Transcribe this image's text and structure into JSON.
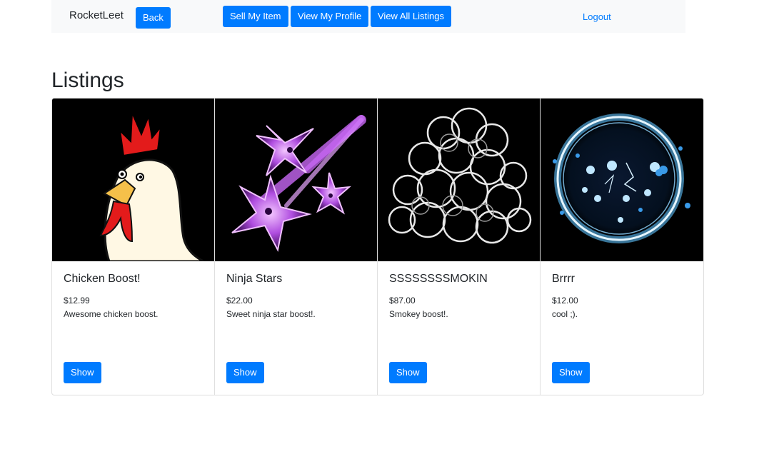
{
  "navbar": {
    "brand": "RocketLeet",
    "back_label": "Back",
    "sell_label": "Sell My Item",
    "profile_label": "View My Profile",
    "all_listings_label": "View All Listings",
    "logout_label": "Logout"
  },
  "page": {
    "title": "Listings"
  },
  "listings": [
    {
      "title": "Chicken Boost!",
      "price": "$12.99",
      "description": "Awesome chicken boost.",
      "show_label": "Show",
      "image": "chicken-image"
    },
    {
      "title": "Ninja Stars",
      "price": "$22.00",
      "description": "Sweet ninja star boost!.",
      "show_label": "Show",
      "image": "ninja-stars-image"
    },
    {
      "title": "SSSSSSSSMOKIN",
      "price": "$87.00",
      "description": "Smokey boost!.",
      "show_label": "Show",
      "image": "smoke-image"
    },
    {
      "title": "Brrrr",
      "price": "$12.00",
      "description": "cool ;).",
      "show_label": "Show",
      "image": "ice-ring-image"
    }
  ],
  "colors": {
    "primary": "#007bff",
    "navbar_bg": "#f8f9fa",
    "image_bg": "#000000"
  }
}
